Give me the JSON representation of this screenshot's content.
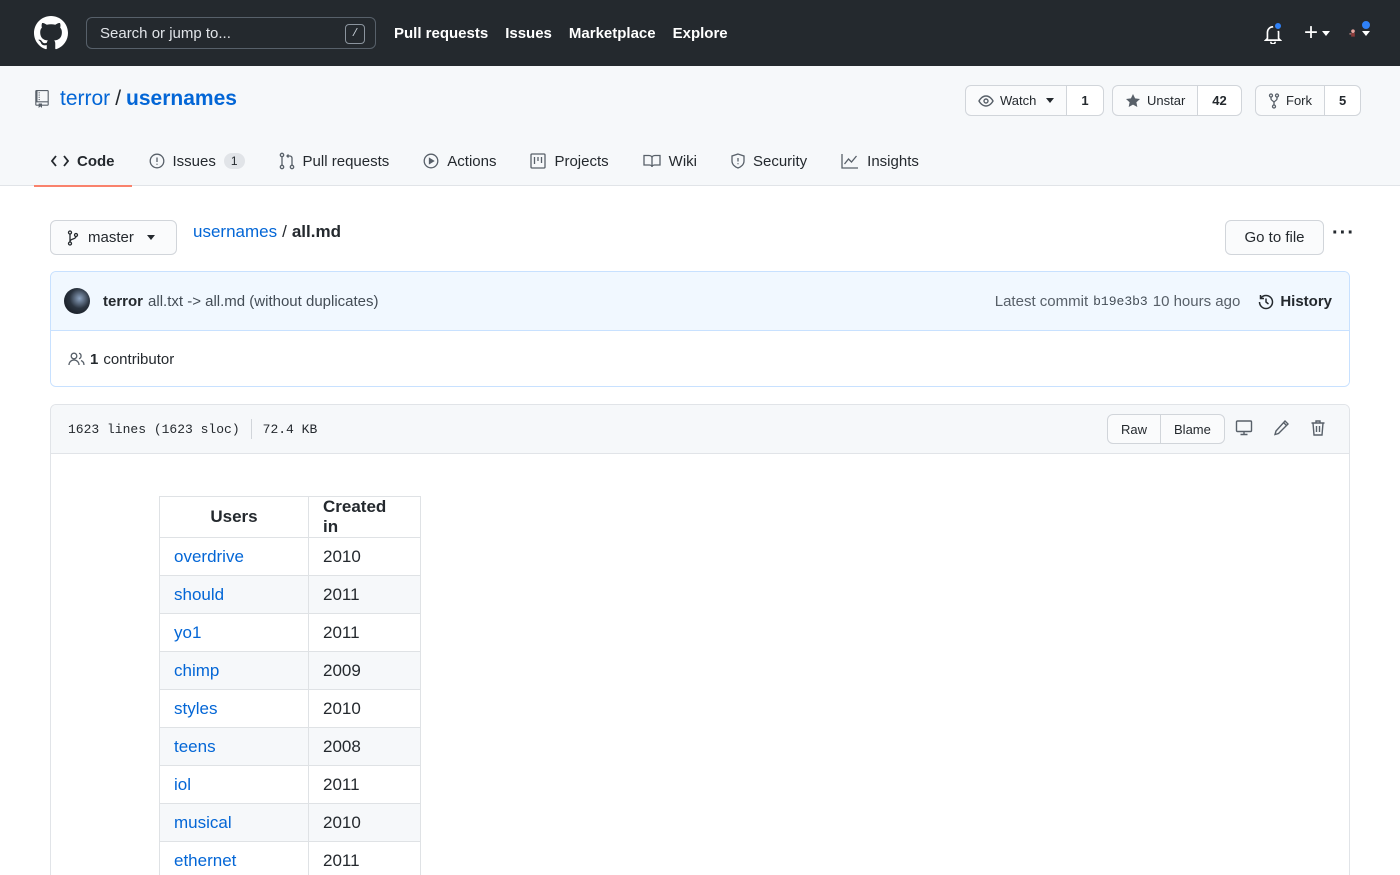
{
  "topbar": {
    "search_placeholder": "Search or jump to...",
    "search_key": "/",
    "nav": [
      "Pull requests",
      "Issues",
      "Marketplace",
      "Explore"
    ],
    "plus": "+"
  },
  "repo": {
    "owner": "terror",
    "separator": "/",
    "name": "usernames",
    "watch_label": "Watch",
    "watch_count": "1",
    "star_label": "Unstar",
    "star_count": "42",
    "fork_label": "Fork",
    "fork_count": "5"
  },
  "tabs": [
    {
      "label": "Code",
      "icon": "code-icon",
      "selected": true
    },
    {
      "label": "Issues",
      "icon": "issue-icon",
      "badge": "1"
    },
    {
      "label": "Pull requests",
      "icon": "pull-request-icon"
    },
    {
      "label": "Actions",
      "icon": "play-icon"
    },
    {
      "label": "Projects",
      "icon": "project-icon"
    },
    {
      "label": "Wiki",
      "icon": "book-icon"
    },
    {
      "label": "Security",
      "icon": "shield-icon"
    },
    {
      "label": "Insights",
      "icon": "graph-icon"
    }
  ],
  "file_nav": {
    "branch": "master",
    "path_repo": "usernames",
    "path_sep": "/",
    "path_file": "all.md",
    "goto_label": "Go to file",
    "more": "···"
  },
  "commit": {
    "author": "terror",
    "message": "all.txt -> all.md (without duplicates)",
    "latest_label": "Latest commit",
    "sha": "b19e3b3",
    "time": "10 hours ago",
    "history_label": "History",
    "contributors_count": "1",
    "contributors_label": "contributor"
  },
  "file": {
    "lines": "1623 lines (1623 sloc)",
    "size": "72.4 KB",
    "raw_label": "Raw",
    "blame_label": "Blame"
  },
  "table": {
    "headers": [
      "Users",
      "Created in"
    ],
    "rows": [
      [
        "overdrive",
        "2010"
      ],
      [
        "should",
        "2011"
      ],
      [
        "yo1",
        "2011"
      ],
      [
        "chimp",
        "2009"
      ],
      [
        "styles",
        "2010"
      ],
      [
        "teens",
        "2008"
      ],
      [
        "iol",
        "2011"
      ],
      [
        "musical",
        "2010"
      ],
      [
        "ethernet",
        "2011"
      ]
    ]
  },
  "colors": {
    "header_bg": "#24292e",
    "link": "#0366d6",
    "tab_underline": "#f9826c",
    "notification_dot": "#2f81f7"
  }
}
